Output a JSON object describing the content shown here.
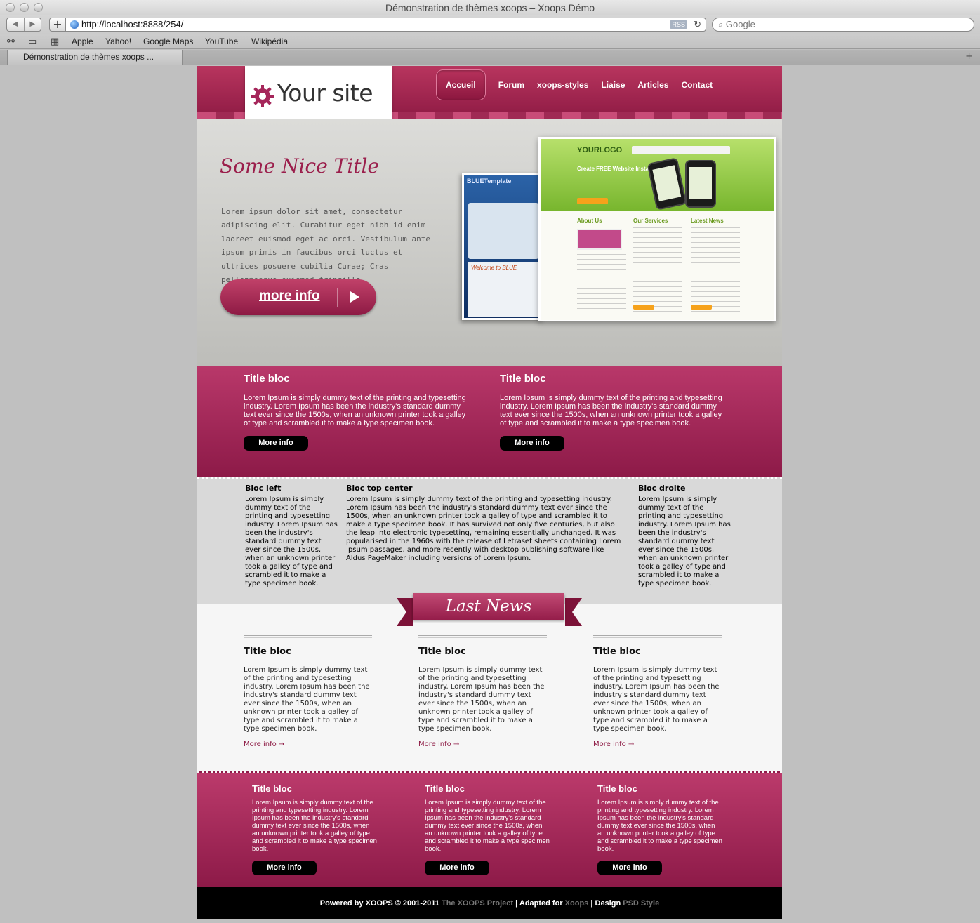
{
  "window": {
    "title": "Démonstration de thèmes xoops – Xoops Démo"
  },
  "toolbar": {
    "url": "http://localhost:8888/254/",
    "rss_label": "RSS",
    "search_placeholder": "Google"
  },
  "bookmarks": [
    "Apple",
    "Yahoo!",
    "Google Maps",
    "YouTube",
    "Wikipédia"
  ],
  "tab": {
    "label": "Démonstration de thèmes xoops ..."
  },
  "site": {
    "logo_text": "Your site",
    "nav": [
      "Accueil",
      "Forum",
      "xoops-styles",
      "Liaise",
      "Articles",
      "Contact"
    ],
    "active_nav": "Accueil",
    "accent_color": "#9b1f4c"
  },
  "hero": {
    "title": "Some Nice Title",
    "text": "Lorem ipsum dolor sit amet, consectetur adipiscing elit. Curabitur eget nibh id enim laoreet euismod eget ac orci. Vestibulum ante ipsum primis in faucibus orci luctus et ultrices posuere cubilia Curae; Cras pellentesque euismod fringilla.",
    "button": "more info",
    "slides": 4,
    "active_slide": 1,
    "screenshot_blue": {
      "header": "BLUETemplate",
      "welcome": "Welcome to BLUE"
    },
    "screenshot_green": {
      "logo": "YOURLOGO",
      "headline": "Create FREE Website Instantly",
      "columns": [
        "About Us",
        "Our Services",
        "Latest News"
      ]
    }
  },
  "top_blocks": [
    {
      "title": "Title bloc",
      "text": "Lorem Ipsum is simply dummy text of the printing and typesetting industry. Lorem Ipsum has been the industry's standard dummy text ever since the 1500s, when an unknown printer took a galley of type and scrambled it to make a type specimen book.",
      "button": "More info"
    },
    {
      "title": "Title bloc",
      "text": "Lorem Ipsum is simply dummy text of the printing and typesetting industry. Lorem Ipsum has been the industry's standard dummy text ever since the 1500s, when an unknown printer took a galley of type and scrambled it to make a type specimen book.",
      "button": "More info"
    }
  ],
  "gray_blocks": {
    "left": {
      "title": "Bloc left",
      "text": "Lorem Ipsum is simply dummy text of the printing and typesetting industry. Lorem Ipsum has been the industry's standard dummy text ever since the 1500s, when an unknown printer took a galley of type and scrambled it to make a type specimen book."
    },
    "center": {
      "title": "Bloc top center",
      "text": "Lorem Ipsum is simply dummy text of the printing and typesetting industry. Lorem Ipsum has been the industry's standard dummy text ever since the 1500s, when an unknown printer took a galley of type and scrambled it to make a type specimen book. It has survived not only five centuries, but also the leap into electronic typesetting, remaining essentially unchanged. It was popularised in the 1960s with the release of Letraset sheets containing Lorem Ipsum passages, and more recently with desktop publishing software like Aldus PageMaker including versions of Lorem Ipsum."
    },
    "right": {
      "title": "Bloc droite",
      "text": "Lorem Ipsum is simply dummy text of the printing and typesetting industry. Lorem Ipsum has been the industry's standard dummy text ever since the 1500s, when an unknown printer took a galley of type and scrambled it to make a type specimen book."
    }
  },
  "last_news": {
    "ribbon": "Last News",
    "items": [
      {
        "title": "Title bloc",
        "text": "Lorem Ipsum is simply dummy text of the printing and typesetting industry. Lorem Ipsum has been the industry's standard dummy text ever since the 1500s, when an unknown printer took a galley of type and scrambled it to make a type specimen book.",
        "more": "More info →"
      },
      {
        "title": "Title bloc",
        "text": "Lorem Ipsum is simply dummy text of the printing and typesetting industry. Lorem Ipsum has been the industry's standard dummy text ever since the 1500s, when an unknown printer took a galley of type and scrambled it to make a type specimen book.",
        "more": "More info →"
      },
      {
        "title": "Title bloc",
        "text": "Lorem Ipsum is simply dummy text of the printing and typesetting industry. Lorem Ipsum has been the industry's standard dummy text ever since the 1500s, when an unknown printer took a galley of type and scrambled it to make a type specimen book.",
        "more": "More info →"
      }
    ]
  },
  "bottom_blocks": [
    {
      "title": "Title bloc",
      "text": "Lorem Ipsum is simply dummy text of the printing and typesetting industry. Lorem Ipsum has been the industry's standard dummy text ever since the 1500s, when an unknown printer took a galley of type and scrambled it to make a type specimen book.",
      "button": "More info"
    },
    {
      "title": "Title bloc",
      "text": "Lorem Ipsum is simply dummy text of the printing and typesetting industry. Lorem Ipsum has been the industry's standard dummy text ever since the 1500s, when an unknown printer took a galley of type and scrambled it to make a type specimen book.",
      "button": "More info"
    },
    {
      "title": "Title bloc",
      "text": "Lorem Ipsum is simply dummy text of the printing and typesetting industry. Lorem Ipsum has been the industry's standard dummy text ever since the 1500s, when an unknown printer took a galley of type and scrambled it to make a type specimen book.",
      "button": "More info"
    }
  ],
  "footer": {
    "powered": "Powered by XOOPS © 2001-2011",
    "project": "The XOOPS Project",
    "sep": "|",
    "adapted": "Adapted for",
    "xoops": "Xoops",
    "design": "Design",
    "psd": "PSD Style"
  }
}
